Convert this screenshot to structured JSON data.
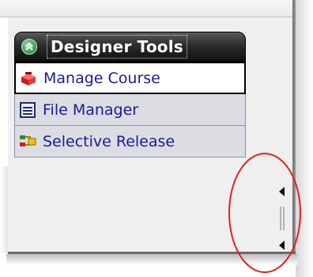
{
  "panel": {
    "title": "Designer Tools",
    "collapse_icon": "double-chevron-up-icon",
    "items": [
      {
        "label": "Manage Course",
        "icon": "toolbox-icon",
        "active": true
      },
      {
        "label": "File Manager",
        "icon": "file-list-icon",
        "active": false
      },
      {
        "label": "Selective Release",
        "icon": "selective-release-icon",
        "active": false
      }
    ]
  },
  "splitter": {
    "icons": [
      "arrow-left-icon",
      "grip-icon",
      "arrow-left-icon"
    ]
  },
  "colors": {
    "header_bg": "#1a1a1a",
    "link_text": "#1a1a9a",
    "item_bg": "#dcdce3",
    "highlight_circle": "#e02020"
  }
}
